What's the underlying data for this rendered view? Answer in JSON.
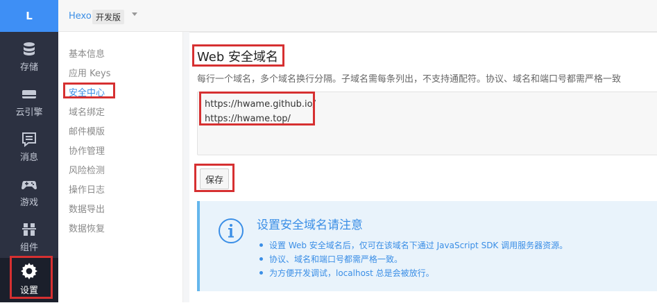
{
  "rail": {
    "logo": "L",
    "items": [
      {
        "label": "存储",
        "icon": "database-icon"
      },
      {
        "label": "云引擎",
        "icon": "server-icon"
      },
      {
        "label": "消息",
        "icon": "message-icon"
      },
      {
        "label": "游戏",
        "icon": "gamepad-icon"
      },
      {
        "label": "组件",
        "icon": "components-icon"
      },
      {
        "label": "设置",
        "icon": "gear-icon"
      }
    ],
    "active": "设置"
  },
  "topbar": {
    "app_name": "Hexo",
    "env": "开发版"
  },
  "submenu": {
    "items": [
      "基本信息",
      "应用 Keys",
      "安全中心",
      "域名绑定",
      "邮件模版",
      "协作管理",
      "风险检测",
      "操作日志",
      "数据导出",
      "数据恢复"
    ],
    "active": "安全中心"
  },
  "main": {
    "title": "Web 安全域名",
    "description": "每行一个域名，多个域名换行分隔。子域名需每条列出，不支持通配符。协议、域名和端口号都需严格一致",
    "domains": [
      "https://hwame.github.io/",
      "https://hwame.top/"
    ],
    "save_label": "保存",
    "notice": {
      "title": "设置安全域名请注意",
      "items": [
        "设置 Web 安全域名后，仅可在该域名下通过 JavaScript SDK 调用服务器资源。",
        "协议、域名和端口号都需严格一致。",
        "为方便开发调试，localhost 总是会被放行。"
      ]
    }
  },
  "colors": {
    "accent": "#3a8ee6",
    "rail_bg": "#2c3141",
    "highlight_box": "#d63031",
    "notice_bg": "#e9f3fb"
  }
}
